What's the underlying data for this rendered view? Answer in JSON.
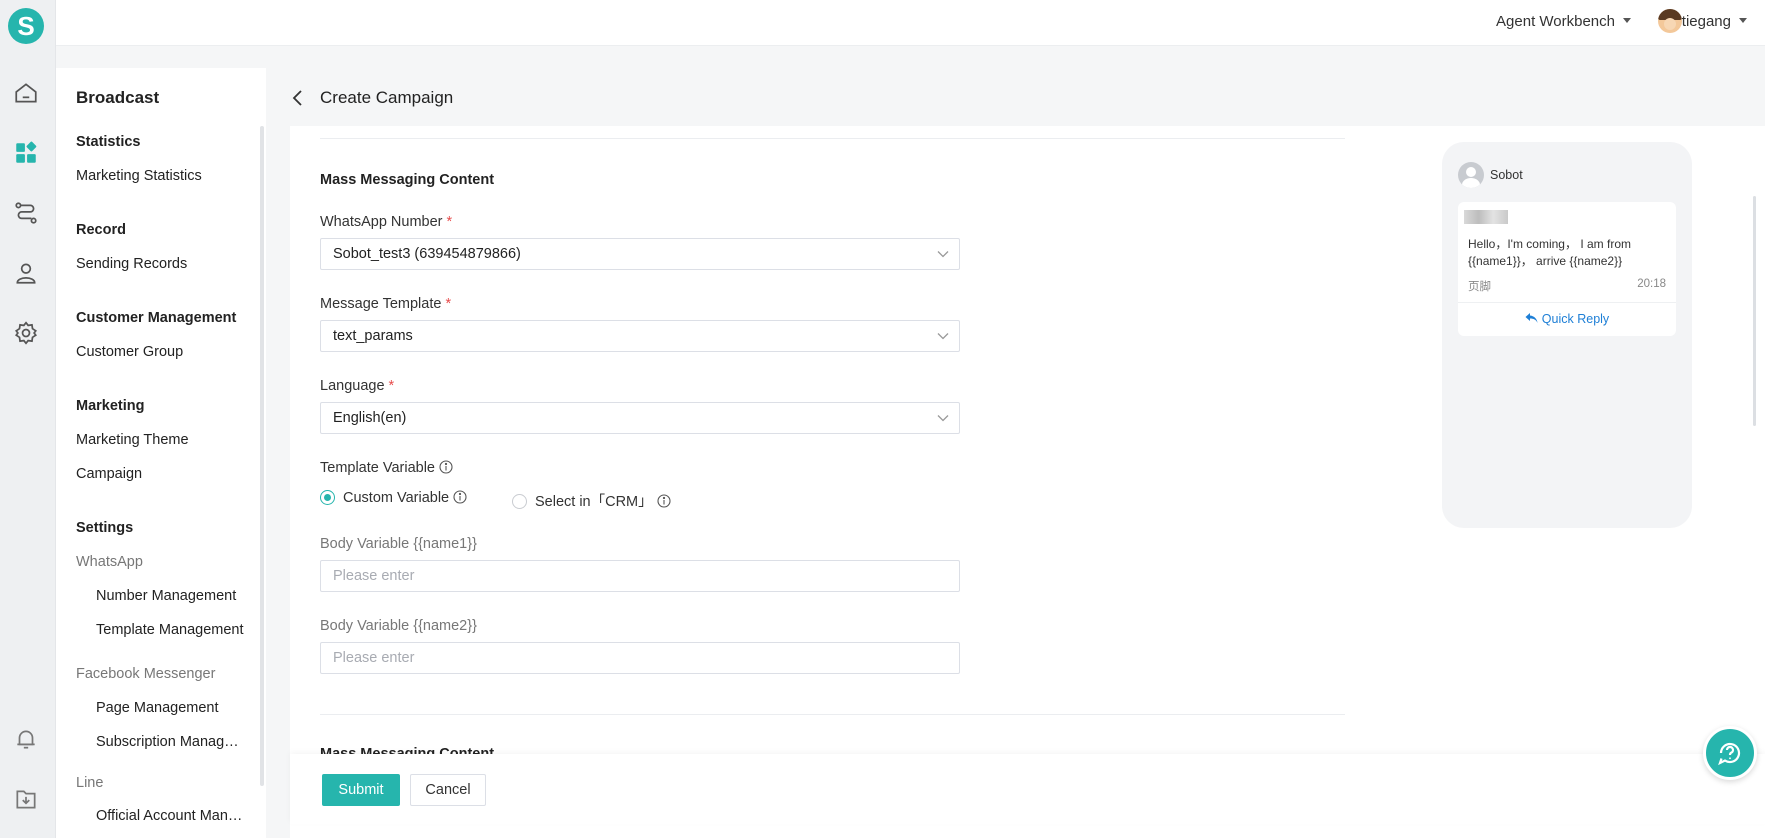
{
  "app": {
    "logo_letter": "S"
  },
  "topbar": {
    "workbench_label": "Agent Workbench",
    "username": "tiegang"
  },
  "nav": {
    "title": "Broadcast",
    "statistics": {
      "heading": "Statistics",
      "items": [
        "Marketing Statistics"
      ]
    },
    "record": {
      "heading": "Record",
      "items": [
        "Sending Records"
      ]
    },
    "customer": {
      "heading": "Customer Management",
      "items": [
        "Customer Group"
      ]
    },
    "marketing": {
      "heading": "Marketing",
      "items": [
        "Marketing Theme",
        "Campaign"
      ]
    },
    "settings": {
      "heading": "Settings",
      "whatsapp": {
        "label": "WhatsApp",
        "items": [
          "Number Management",
          "Template Management"
        ]
      },
      "facebook": {
        "label": "Facebook Messenger",
        "items": [
          "Page Management",
          "Subscription Management"
        ]
      },
      "line": {
        "label": "Line",
        "items": [
          "Official Account Management"
        ]
      }
    }
  },
  "page": {
    "title": "Create Campaign"
  },
  "form": {
    "section_title": "Mass Messaging Content",
    "next_section_title": "Mass Messaging Content",
    "whatsapp_number": {
      "label": "WhatsApp Number",
      "required_mark": "*",
      "value": "Sobot_test3 (639454879866)"
    },
    "message_template": {
      "label": "Message Template",
      "required_mark": "*",
      "value": "text_params"
    },
    "language": {
      "label": "Language",
      "required_mark": "*",
      "value": "English(en)"
    },
    "template_variable": {
      "label": "Template Variable",
      "options": [
        {
          "label": "Custom Variable",
          "selected": true
        },
        {
          "label": "Select in「CRM」",
          "selected": false
        }
      ]
    },
    "body_var1": {
      "label": "Body Variable {{name1}}",
      "placeholder": "Please enter"
    },
    "body_var2": {
      "label": "Body Variable {{name2}}",
      "placeholder": "Please enter"
    }
  },
  "preview": {
    "sender": "Sobot",
    "message": "Hello，I'm coming， I am from {{name1}}， arrive {{name2}}",
    "footer": "页脚",
    "time": "20:18",
    "quick_reply": "Quick Reply"
  },
  "actions": {
    "submit": "Submit",
    "cancel": "Cancel"
  },
  "colors": {
    "accent": "#26b5ad",
    "link": "#1e7fd6",
    "required": "#e74c4c"
  }
}
